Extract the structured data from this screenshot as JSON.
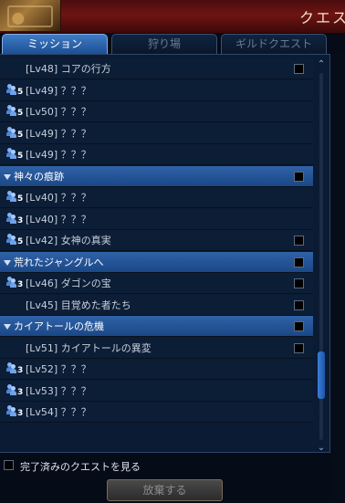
{
  "window": {
    "title": "クエス"
  },
  "tabs": [
    {
      "label": "ミッション",
      "active": true
    },
    {
      "label": "狩り場",
      "active": false
    },
    {
      "label": "ギルドクエスト",
      "active": false
    }
  ],
  "quest_list": [
    {
      "kind": "quest",
      "label": "[Lv48] コアの行方",
      "party": null,
      "checkbox": true
    },
    {
      "kind": "quest",
      "label": "[Lv49] ？？？",
      "party": "5",
      "checkbox": false
    },
    {
      "kind": "quest",
      "label": "[Lv50] ？？？",
      "party": "5",
      "checkbox": false
    },
    {
      "kind": "quest",
      "label": "[Lv49] ？？？",
      "party": "5",
      "checkbox": false
    },
    {
      "kind": "quest",
      "label": "[Lv49] ？？？",
      "party": "5",
      "checkbox": false
    },
    {
      "kind": "group",
      "label": "神々の痕跡",
      "checkbox": true
    },
    {
      "kind": "quest",
      "label": "[Lv40] ？？？",
      "party": "5",
      "checkbox": false
    },
    {
      "kind": "quest",
      "label": "[Lv40] ？？？",
      "party": "3",
      "checkbox": false
    },
    {
      "kind": "quest",
      "label": "[Lv42] 女神の真実",
      "party": "5",
      "checkbox": true
    },
    {
      "kind": "group",
      "label": "荒れたジャングルへ",
      "checkbox": true
    },
    {
      "kind": "quest",
      "label": "[Lv46] ダゴンの宝",
      "party": "3",
      "checkbox": true
    },
    {
      "kind": "quest",
      "label": "[Lv45] 目覚めた者たち",
      "party": null,
      "checkbox": true
    },
    {
      "kind": "group",
      "label": "カイアトールの危機",
      "checkbox": true
    },
    {
      "kind": "quest",
      "label": "[Lv51] カイアトールの異変",
      "party": null,
      "checkbox": true
    },
    {
      "kind": "quest",
      "label": "[Lv52] ？？？",
      "party": "3",
      "checkbox": false
    },
    {
      "kind": "quest",
      "label": "[Lv53] ？？？",
      "party": "3",
      "checkbox": false
    },
    {
      "kind": "quest",
      "label": "[Lv54] ？？？",
      "party": "3",
      "checkbox": false
    }
  ],
  "scrollbar": {
    "position": 0.87
  },
  "footer": {
    "show_completed_label": "完了済みのクエストを見る",
    "abandon_label": "放棄する"
  },
  "colors": {
    "active_tab": "#2f6bb8",
    "group_header": "#2a5aa0",
    "header_red": "#6e1414"
  }
}
